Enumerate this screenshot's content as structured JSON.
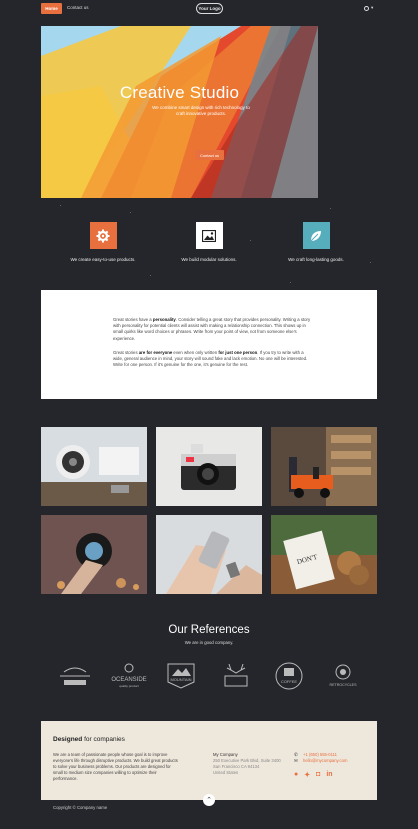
{
  "nav": {
    "home": "Home",
    "contact": "Contact us",
    "logo": "Your Logo"
  },
  "hero": {
    "title": "Creative Studio",
    "subtitle": "We combine smart design with rich technology to craft innovative products.",
    "button": "Contact us"
  },
  "features": [
    {
      "icon": "gear-icon",
      "caption": "We create easy-to-use products.",
      "color": "#e8703f"
    },
    {
      "icon": "picture-icon",
      "caption": "We build modular solutions.",
      "color": "#ffffff"
    },
    {
      "icon": "leaf-icon",
      "caption": "We craft long-lasting goods.",
      "color": "#56aebc"
    }
  ],
  "story": {
    "p1_a": "Great stories have a ",
    "p1_b": "personality",
    "p1_c": ". Consider telling a great story that provides personality. Writing a story with personality for potential clients will assist with making a relationship connection. This shows up in small quirks like word choices or phrases. Write from your point of view, not from someone else's experience.",
    "p2_a": "Great stories ",
    "p2_b": "are for everyone",
    "p2_c": " even when only written ",
    "p2_d": "for just one person",
    "p2_e": ". If you try to write with a wide, general audience in mind, your story will sound fake and lack emotion. No one will be interested. Write for one person. If it's genuine for the one, it's genuine for the rest."
  },
  "references": {
    "title": "Our References",
    "subtitle": "We are in good company.",
    "logos": [
      "Badge logo",
      "Oceanside",
      "Mountain",
      "Antler",
      "Coffee",
      "Retrocycles"
    ]
  },
  "footer": {
    "title_a": "Designed",
    "title_b": " for companies",
    "description": "We are a team of passionate people whose goal is to improve everyone's life through disruptive products. We build great products to solve your business problems. Our products are designed for small to medium size companies willing to optimize their performance.",
    "company": "My Company",
    "address1": "250 Executive Park Blvd, Suite 3400",
    "address2": "San Francisco CA 94134",
    "address3": "United States",
    "phone": "+1 (650) 555-0111",
    "email": "hello@mycompany.com",
    "copyright": "Copyright © Company name"
  }
}
